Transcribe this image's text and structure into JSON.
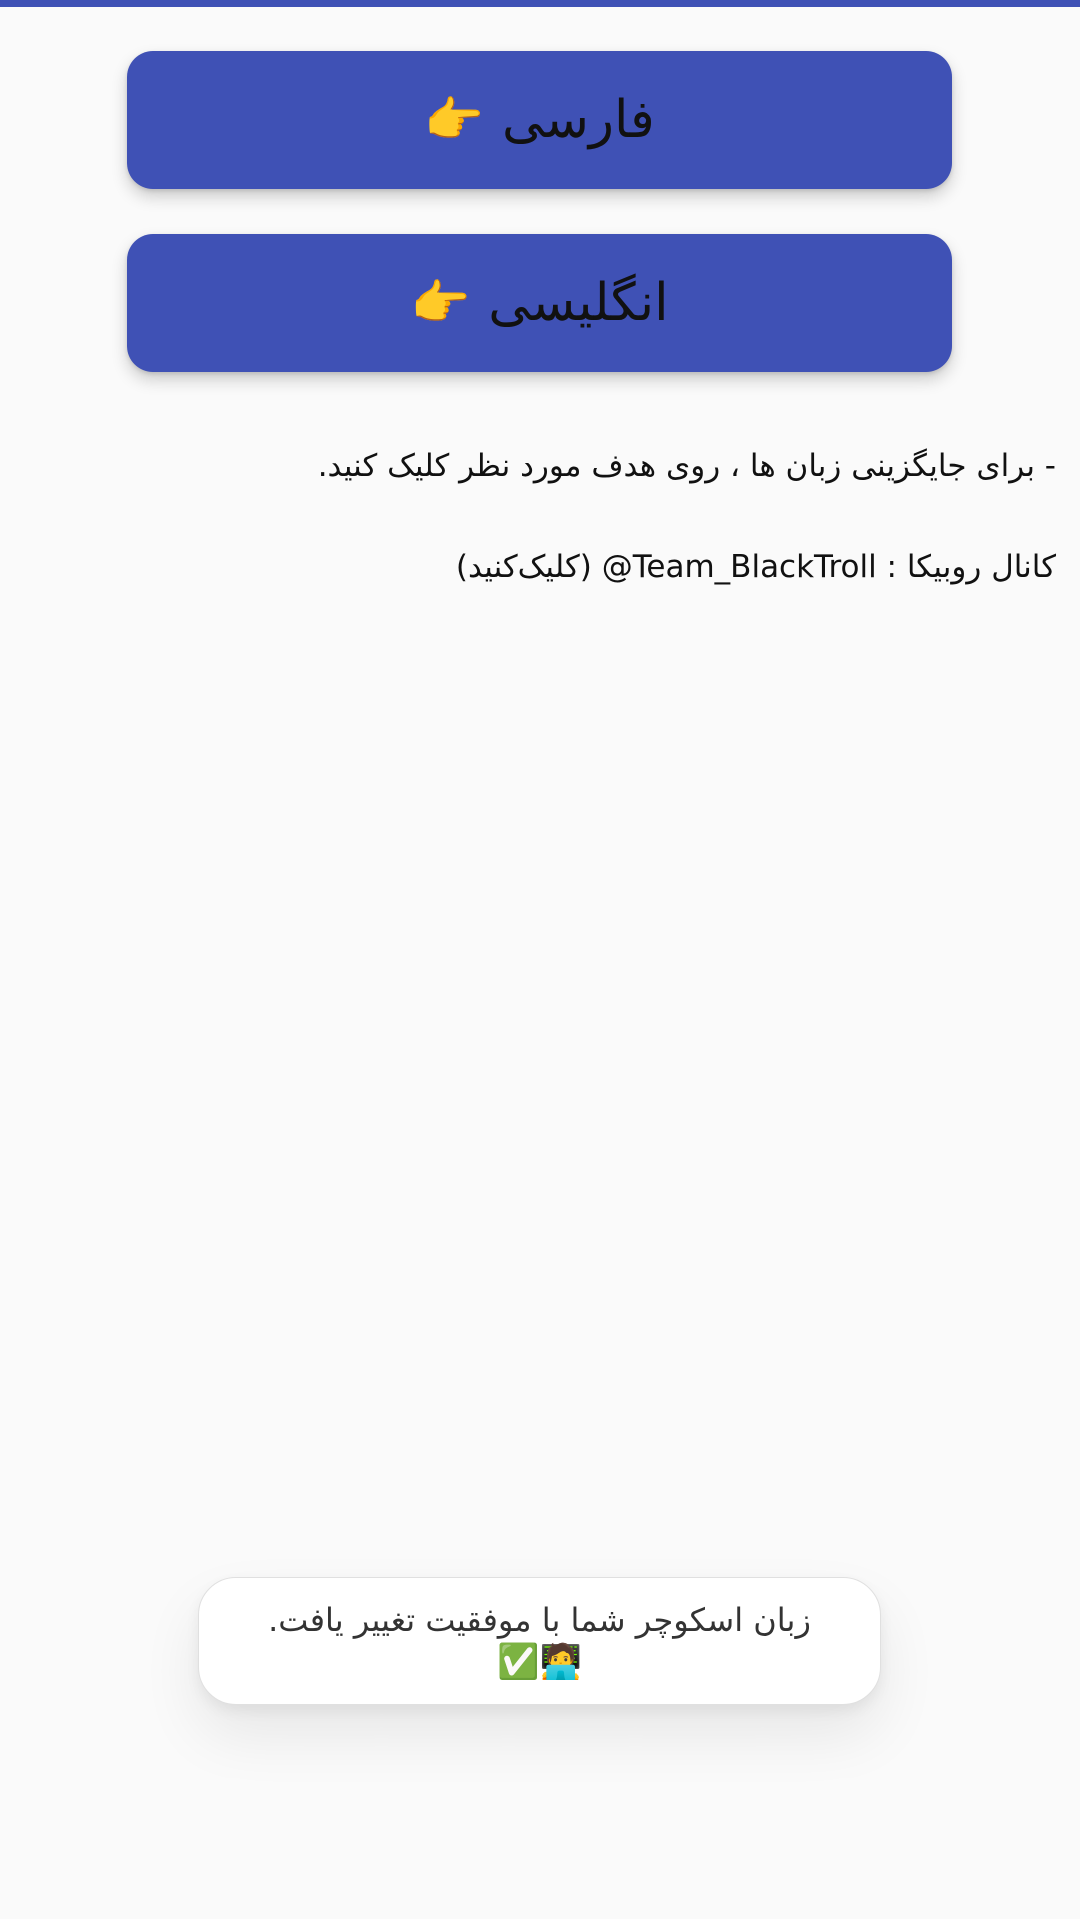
{
  "theme": {
    "primary_color": "#3f51b5",
    "background_color": "#fafafa",
    "toast_background": "#ffffff"
  },
  "language_buttons": [
    {
      "label": "فارسی",
      "icon": "backhand-index-pointing-right-icon",
      "glyph": "👉"
    },
    {
      "label": "انگلیسی",
      "icon": "backhand-index-pointing-right-icon",
      "glyph": "👉"
    }
  ],
  "info": {
    "instruction": "- برای جایگزینی زبان ها ، روی هدف مورد نظر کلیک کنید.",
    "channel": "کانال روبیکا : ‎@Team_BlackTroll‎ (کلیک‌کنید)"
  },
  "toast": {
    "message": "زبان اسکوچر شما با موفقیت تغییر یافت.",
    "icons_glyphs": "🧑‍💻✅",
    "icon_names": [
      "technologist-icon",
      "check-mark-button-icon"
    ]
  }
}
